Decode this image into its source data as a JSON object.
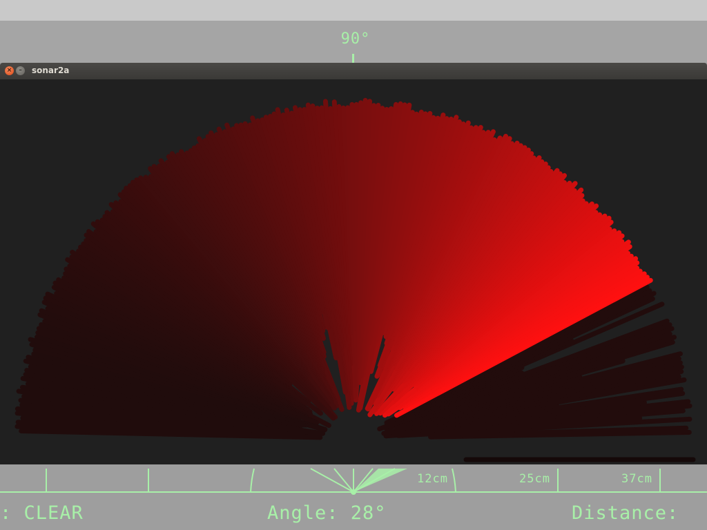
{
  "background_radar": {
    "angle_label": "90°",
    "range_labels": [
      "12cm",
      "25cm",
      "37cm"
    ],
    "status": ": CLEAR",
    "angle_text": "Angle: 28°",
    "distance_text": "Distance:"
  },
  "window": {
    "title": "sonar2a",
    "close_glyph": "×",
    "minimize_glyph": "–"
  },
  "sonar": {
    "current_angle_deg": 28,
    "max_range_fraction": 1.0,
    "colors": {
      "background": "#202020",
      "beam_hot": "#ff1010",
      "beam_dim": "#200c0c",
      "grid_green": "#a8f0a8"
    }
  }
}
